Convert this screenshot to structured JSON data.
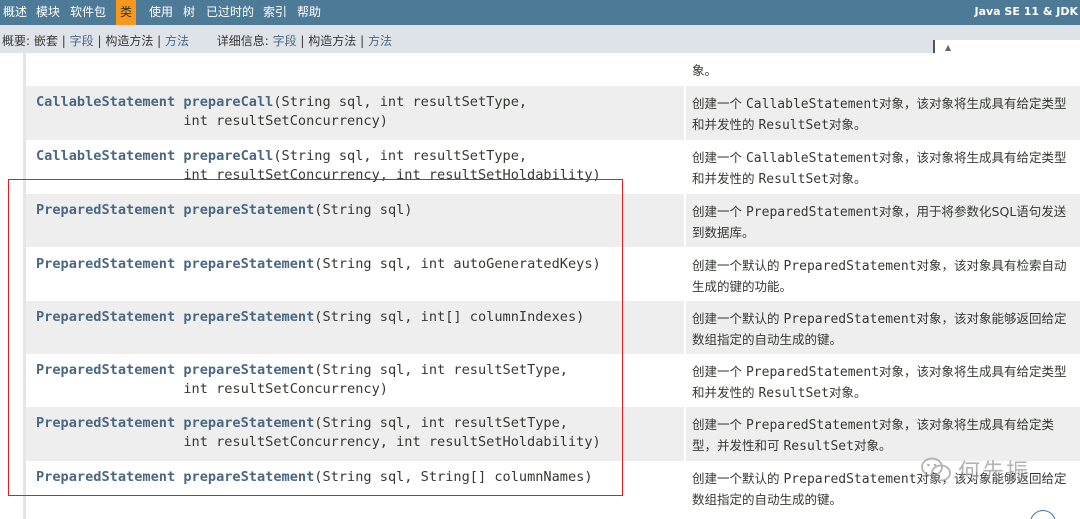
{
  "topnav": {
    "items": [
      {
        "label": "概述",
        "active": false
      },
      {
        "label": "模块",
        "active": false
      },
      {
        "label": "软件包",
        "active": false
      },
      {
        "label": "类",
        "active": true
      },
      {
        "label": "使用",
        "active": false
      },
      {
        "label": "树",
        "active": false
      },
      {
        "label": "已过时的",
        "active": false
      },
      {
        "label": "索引",
        "active": false
      },
      {
        "label": "帮助",
        "active": false
      }
    ],
    "brand": "Java SE 11 & JDK"
  },
  "subnav": {
    "summary_label": "概要:",
    "summary_nested": "嵌套",
    "summary_field": "字段",
    "summary_constr": "构造方法",
    "summary_method": "方法",
    "detail_label": "详细信息:",
    "detail_field": "字段",
    "detail_constr": "构造方法",
    "detail_method": "方法",
    "sep": "|"
  },
  "top_partial": {
    "desc": "象。"
  },
  "rows": [
    {
      "ret": "CallableStatement",
      "name": "prepareCall",
      "params_line1": "(String sql, int resultSetType,",
      "params_line2": "int resultSetConcurrency)",
      "desc_pre": "创建一个 ",
      "desc_code": "CallableStatement",
      "desc_mid": "对象，该对象将生成具有给定类型和并发性的 ",
      "desc_code2": "ResultSet",
      "desc_post": "对象。"
    },
    {
      "ret": "CallableStatement",
      "name": "prepareCall",
      "params_line1": "(String sql, int resultSetType,",
      "params_line2": "int resultSetConcurrency, int resultSetHoldability)",
      "desc_pre": "创建一个 ",
      "desc_code": "CallableStatement",
      "desc_mid": "对象，该对象将生成具有给定类型和并发性的 ",
      "desc_code2": "ResultSet",
      "desc_post": "对象。"
    },
    {
      "ret": "PreparedStatement",
      "name": "prepareStatement",
      "params_line1": "(String sql)",
      "params_line2": "",
      "desc_pre": "创建一个 ",
      "desc_code": "PreparedStatement",
      "desc_mid": "对象，用于将参数化SQL语句发送到数据库。",
      "desc_code2": "",
      "desc_post": ""
    },
    {
      "ret": "PreparedStatement",
      "name": "prepareStatement",
      "params_line1": "(String sql, int autoGeneratedKeys)",
      "params_line2": "",
      "desc_pre": "创建一个默认的 ",
      "desc_code": "PreparedStatement",
      "desc_mid": "对象，该对象具有检索自动生成的键的功能。",
      "desc_code2": "",
      "desc_post": ""
    },
    {
      "ret": "PreparedStatement",
      "name": "prepareStatement",
      "params_line1": "(String sql, int[] columnIndexes)",
      "params_line2": "",
      "desc_pre": "创建一个默认的 ",
      "desc_code": "PreparedStatement",
      "desc_mid": "对象，该对象能够返回给定数组指定的自动生成的键。",
      "desc_code2": "",
      "desc_post": ""
    },
    {
      "ret": "PreparedStatement",
      "name": "prepareStatement",
      "params_line1": "(String sql, int resultSetType,",
      "params_line2": "int resultSetConcurrency)",
      "desc_pre": "创建一个 ",
      "desc_code": "PreparedStatement",
      "desc_mid": "对象，该对象将生成具有给定类型和并发性的 ",
      "desc_code2": "ResultSet",
      "desc_post": "对象。"
    },
    {
      "ret": "PreparedStatement",
      "name": "prepareStatement",
      "params_line1": "(String sql, int resultSetType,",
      "params_line2": "int resultSetConcurrency, int resultSetHoldability)",
      "desc_pre": "创建一个 ",
      "desc_code": "PreparedStatement",
      "desc_mid": "对象，该对象将生成具有给定类型，并发性和可 ",
      "desc_code2": "ResultSet",
      "desc_post": "对象。"
    },
    {
      "ret": "PreparedStatement",
      "name": "prepareStatement",
      "params_line1": "(String sql, String[] columnNames)",
      "params_line2": "",
      "desc_pre": "创建一个默认的 ",
      "desc_code": "PreparedStatement",
      "desc_mid": "对象，该对象能够返回给定数组指定的自动生成的键。",
      "desc_code2": "",
      "desc_post": ""
    }
  ],
  "watermark": {
    "text": "何先振",
    "icon": "wechat-icon"
  },
  "colors": {
    "nav_bg": "#4d7a97",
    "nav_active": "#f8981d",
    "subnav_bg": "#dee3e9",
    "link": "#4a6782",
    "highlight_box": "#e02020"
  }
}
